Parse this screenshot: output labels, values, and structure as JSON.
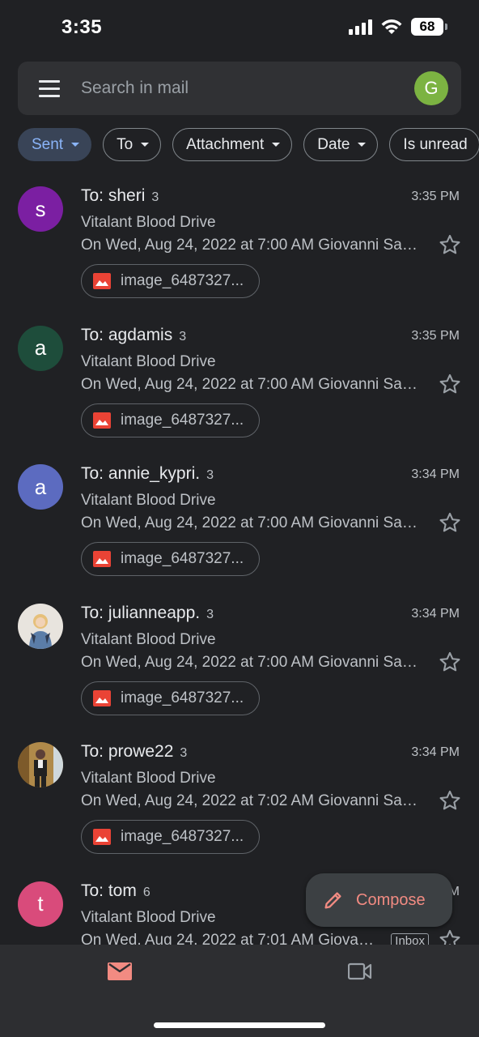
{
  "status": {
    "time": "3:35",
    "battery": "68"
  },
  "search": {
    "placeholder": "Search in mail",
    "avatar_letter": "G",
    "avatar_color": "#7cb342"
  },
  "filters": [
    "Sent",
    "To",
    "Attachment",
    "Date",
    "Is unread"
  ],
  "emails": [
    {
      "to": "To: sheri",
      "count": "3",
      "time": "3:35 PM",
      "subject": "Vitalant Blood Drive",
      "snippet": "On Wed, Aug 24, 2022 at 7:00 AM Giovanni Santos wrote:",
      "attachment": "image_6487327...",
      "avatar_letter": "s",
      "avatar_color": "#7b1fa2"
    },
    {
      "to": "To: agdamis",
      "count": "3",
      "time": "3:35 PM",
      "subject": "Vitalant Blood Drive",
      "snippet": "On Wed, Aug 24, 2022 at 7:00 AM Giovanni Santos wrote:",
      "attachment": "image_6487327...",
      "avatar_letter": "a",
      "avatar_color": "#1e4d3b"
    },
    {
      "to": "To: annie_kypri.",
      "count": "3",
      "time": "3:34 PM",
      "subject": "Vitalant Blood Drive",
      "snippet": "On Wed, Aug 24, 2022 at 7:00 AM Giovanni Santos wrote:",
      "attachment": "image_6487327...",
      "avatar_letter": "a",
      "avatar_color": "#5c6bc0"
    },
    {
      "to": "To: julianneарр.",
      "count": "3",
      "time": "3:34 PM",
      "subject": "Vitalant Blood Drive",
      "snippet": "On Wed, Aug 24, 2022 at 7:00 AM Giovanni Santos wrote:",
      "attachment": "image_6487327...",
      "avatar_letter": "",
      "avatar_color": "#e8e4de"
    },
    {
      "to": "To: prowe22",
      "count": "3",
      "time": "3:34 PM",
      "subject": "Vitalant Blood Drive",
      "snippet": "On Wed, Aug 24, 2022 at 7:02 AM Giovanni Santos wrote:",
      "attachment": "image_6487327...",
      "avatar_letter": "",
      "avatar_color": "#b08a4a"
    },
    {
      "to": "To: tom",
      "count": "6",
      "time": "3:33 PM",
      "subject": "Vitalant Blood Drive",
      "snippet": "On Wed, Aug 24, 2022 at 7:01 AM Giovanni Santos wrote:",
      "attachment": "",
      "avatar_letter": "t",
      "avatar_color": "#d94b7b",
      "badge": "Inbox"
    }
  ],
  "compose": {
    "label": "Compose"
  },
  "colors": {
    "accent": "#f28b82",
    "background": "#202124"
  }
}
